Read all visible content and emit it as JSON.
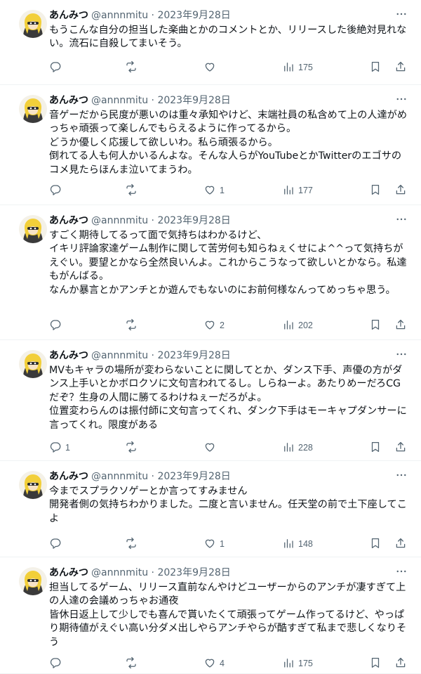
{
  "tweets": [
    {
      "name": "あんみつ",
      "handle": "@annnmitu",
      "separator": "·",
      "date": "2023年9月28日",
      "text": "もうこんな自分の担当した楽曲とかのコメントとか、リリースした後絶対見れない。流石に自殺してまいそう。",
      "replies": "",
      "retweets": "",
      "likes": "",
      "views": "175"
    },
    {
      "name": "あんみつ",
      "handle": "@annnmitu",
      "separator": "·",
      "date": "2023年9月28日",
      "text": "音ゲーだから民度が悪いのは重々承知やけど、末端社員の私含めて上の人達がめっちゃ頑張って楽しんでもらえるように作ってるから。\nどうか優しく応援して欲しいわ。私ら頑張るから。\n倒れてる人も何人かいるんよな。そんな人らがYouTubeとかTwitterのエゴサのコメ見たらほんま泣いてまうわ。",
      "replies": "",
      "retweets": "",
      "likes": "1",
      "views": "177"
    },
    {
      "name": "あんみつ",
      "handle": "@annnmitu",
      "separator": "·",
      "date": "2023年9月28日",
      "text": "すごく期待してるって面で気持ちはわかるけど、\nイキリ評論家達ゲーム制作に関して苦労何も知らねぇくせによ^^って気持ちがえぐい。要望とかなら全然良いんよ。これからこうなって欲しいとかなら。私達もがんばる。\nなんか暴言とかアンチとか遊んでもないのにお前何様なんってめっちゃ思う。",
      "replies": "",
      "retweets": "",
      "likes": "2",
      "views": "202"
    },
    {
      "name": "あんみつ",
      "handle": "@annnmitu",
      "separator": "·",
      "date": "2023年9月28日",
      "text": "MVもキャラの場所が変わらないことに関してとか、ダンス下手、声優の方がダンス上手いとかボロクソに文句言われてるし。しらねーよ。あたりめーだろCGだぞ？生身の人間に勝てるわけねぇーだろがよ。\n位置変わらんのは振付師に文句言ってくれ、ダンク下手はモーキャプダンサーに言ってくれ。限度がある",
      "replies": "1",
      "retweets": "",
      "likes": "",
      "views": "228"
    },
    {
      "name": "あんみつ",
      "handle": "@annnmitu",
      "separator": "·",
      "date": "2023年9月28日",
      "text": "今までスプラクソゲーとか言ってすみません\n開発者側の気持ちわかりました。二度と言いません。任天堂の前で土下座してこよ",
      "replies": "",
      "retweets": "",
      "likes": "1",
      "views": "148"
    },
    {
      "name": "あんみつ",
      "handle": "@annnmitu",
      "separator": "·",
      "date": "2023年9月28日",
      "text": "担当してるゲーム、リリース直前なんやけどユーザーからのアンチが凄すぎて上の人達の会議めっちゃお通夜\n皆休日返上して少しでも喜んで貰いたくて頑張ってゲーム作ってるけど、やっぱり期待値がえぐい高い分ダメ出しやらアンチやらが酷すぎて私まで悲しくなりそう",
      "replies": "",
      "retweets": "",
      "likes": "4",
      "views": "175"
    }
  ],
  "icons": {
    "more": "more-icon",
    "reply": "reply-icon",
    "retweet": "retweet-icon",
    "like": "heart-icon",
    "views": "views-icon",
    "bookmark": "bookmark-icon",
    "share": "share-icon"
  },
  "colors": {
    "text": "#0f1419",
    "secondary": "#536471",
    "divider": "#eff3f4",
    "avatar_yellow": "#f2cf3a"
  }
}
